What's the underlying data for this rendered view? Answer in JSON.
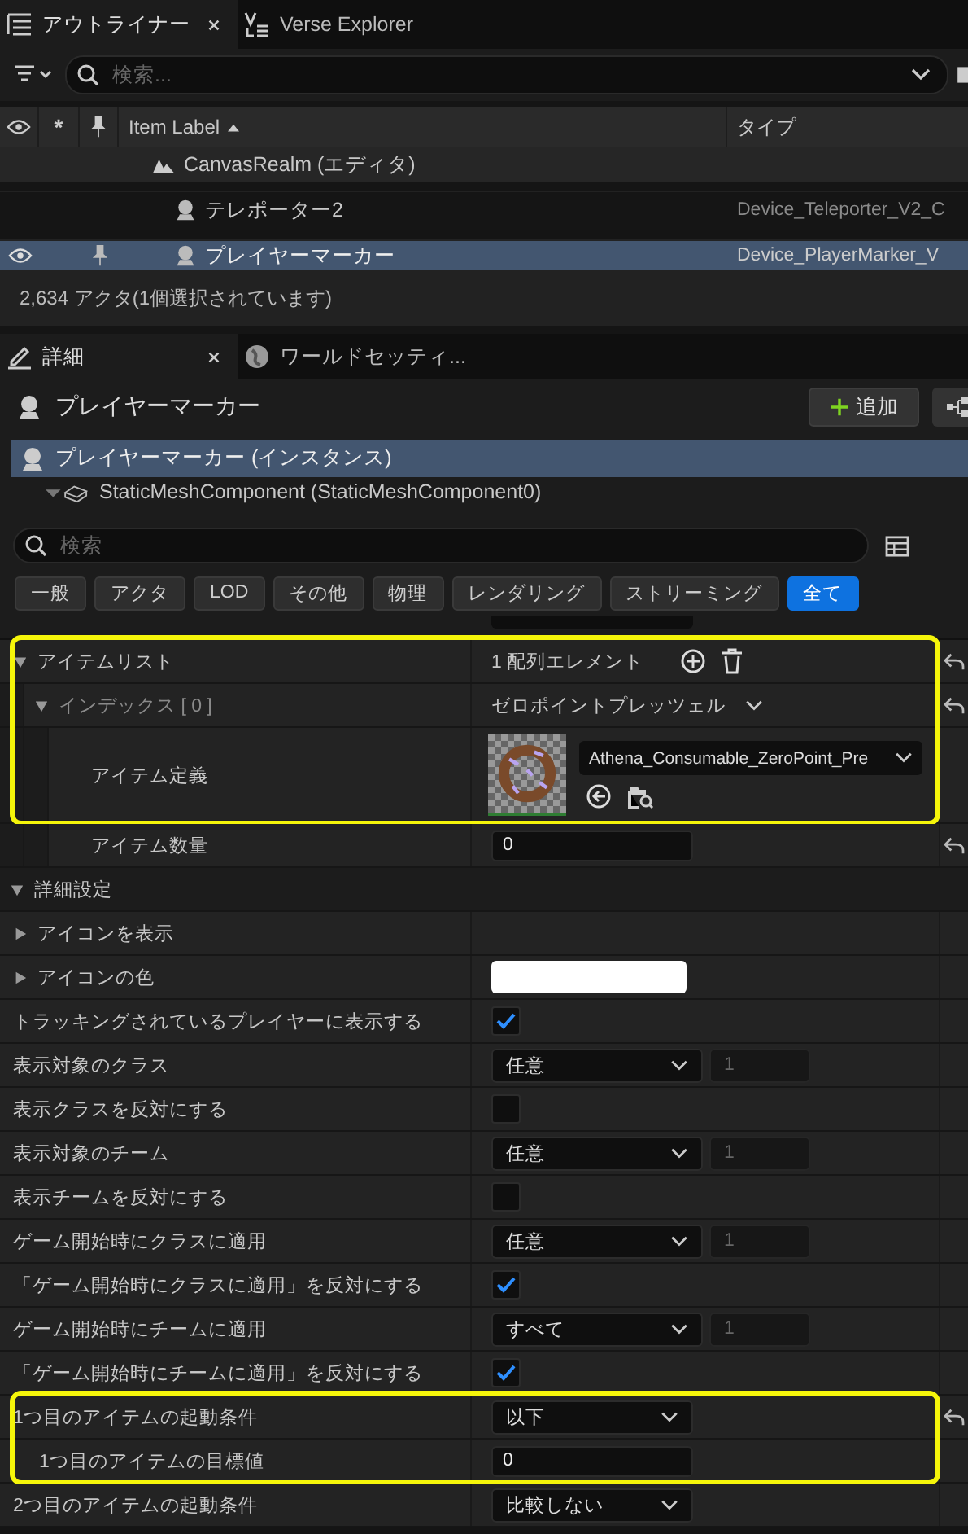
{
  "outliner": {
    "tabs": [
      {
        "label": "アウトライナー",
        "selected": true
      },
      {
        "label": "Verse Explorer",
        "selected": false
      }
    ],
    "search": {
      "placeholder": "検索..."
    },
    "columns": {
      "star": "*",
      "label": "Item Label",
      "type": "タイプ"
    },
    "rows": [
      {
        "kind": "realm",
        "label": "CanvasRealm (エディタ)",
        "visible": false,
        "pinned": false,
        "selected": false
      },
      {
        "kind": "device",
        "label": "テレポーター2",
        "type": "Device_Teleporter_V2_C",
        "visible": false,
        "pinned": false,
        "selected": false
      },
      {
        "kind": "device",
        "label": "プレイヤーマーカー",
        "type": "Device_PlayerMarker_V",
        "visible": true,
        "pinned": true,
        "selected": true
      }
    ],
    "status": "2,634 アクタ(1個選択されています)"
  },
  "details": {
    "tabs": [
      {
        "label": "詳細",
        "selected": true
      },
      {
        "label": "ワールドセッティ...",
        "selected": false
      }
    ],
    "actor": "プレイヤーマーカー",
    "add_button": "追加",
    "components": [
      {
        "label": "プレイヤーマーカー (インスタンス)",
        "selected": true,
        "kind": "actor"
      },
      {
        "label": "StaticMeshComponent (StaticMeshComponent0)",
        "selected": false,
        "kind": "mesh"
      }
    ],
    "search": {
      "placeholder": "検索"
    },
    "filters": [
      {
        "label": "一般",
        "selected": false
      },
      {
        "label": "アクタ",
        "selected": false
      },
      {
        "label": "LOD",
        "selected": false
      },
      {
        "label": "その他",
        "selected": false
      },
      {
        "label": "物理",
        "selected": false
      },
      {
        "label": "レンダリング",
        "selected": false
      },
      {
        "label": "ストリーミング",
        "selected": false
      },
      {
        "label": "全て",
        "selected": true
      }
    ],
    "properties": [
      {
        "kind": "array",
        "label": "アイテムリスト",
        "value": "1 配列エレメント",
        "expanded": true,
        "reset": true,
        "highlighted": true,
        "children": [
          {
            "kind": "index",
            "label": "インデックス [ 0 ]",
            "value": "ゼロポイントプレッツェル",
            "expanded": true,
            "reset": true,
            "highlighted": true,
            "children": [
              {
                "kind": "asset",
                "label": "アイテム定義",
                "value": "Athena_Consumable_ZeroPoint_Pre",
                "reset": false,
                "highlighted": true
              },
              {
                "kind": "number",
                "label": "アイテム数量",
                "value": "0",
                "reset": true,
                "highlighted": false
              }
            ]
          }
        ]
      },
      {
        "kind": "category",
        "label": "詳細設定",
        "expanded": true,
        "reset": false,
        "highlighted": false
      },
      {
        "kind": "expander",
        "label": "アイコンを表示",
        "expanded": false,
        "reset": false,
        "highlighted": false
      },
      {
        "kind": "color",
        "label": "アイコンの色",
        "expanded": false,
        "color": "#ffffff",
        "reset": false,
        "highlighted": false
      },
      {
        "kind": "checkbox",
        "label": "トラッキングされているプレイヤーに表示する",
        "checked": true,
        "reset": false,
        "highlighted": false
      },
      {
        "kind": "dropdown",
        "label": "表示対象のクラス",
        "value": "任意",
        "number": "1",
        "reset": false,
        "highlighted": false
      },
      {
        "kind": "checkbox",
        "label": "表示クラスを反対にする",
        "checked": false,
        "reset": false,
        "highlighted": false
      },
      {
        "kind": "dropdown",
        "label": "表示対象のチーム",
        "value": "任意",
        "number": "1",
        "reset": false,
        "highlighted": false
      },
      {
        "kind": "checkbox",
        "label": "表示チームを反対にする",
        "checked": false,
        "reset": false,
        "highlighted": false
      },
      {
        "kind": "dropdown",
        "label": "ゲーム開始時にクラスに適用",
        "value": "任意",
        "number": "1",
        "reset": false,
        "highlighted": false
      },
      {
        "kind": "checkbox",
        "label": "「ゲーム開始時にクラスに適用」を反対にする",
        "checked": true,
        "reset": false,
        "highlighted": false
      },
      {
        "kind": "dropdown",
        "label": "ゲーム開始時にチームに適用",
        "value": "すべて",
        "number": "1",
        "reset": false,
        "highlighted": false
      },
      {
        "kind": "checkbox",
        "label": "「ゲーム開始時にチームに適用」を反対にする",
        "checked": true,
        "reset": false,
        "highlighted": false
      },
      {
        "kind": "dropdown",
        "label": "1つ目のアイテムの起動条件",
        "value": "以下",
        "reset": true,
        "highlighted": true
      },
      {
        "kind": "number",
        "label": "1つ目のアイテムの目標値",
        "value": "0",
        "reset": false,
        "highlighted": true
      },
      {
        "kind": "dropdown",
        "label": "2つ目のアイテムの起動条件",
        "value": "比較しない",
        "reset": false,
        "highlighted": false
      }
    ]
  }
}
